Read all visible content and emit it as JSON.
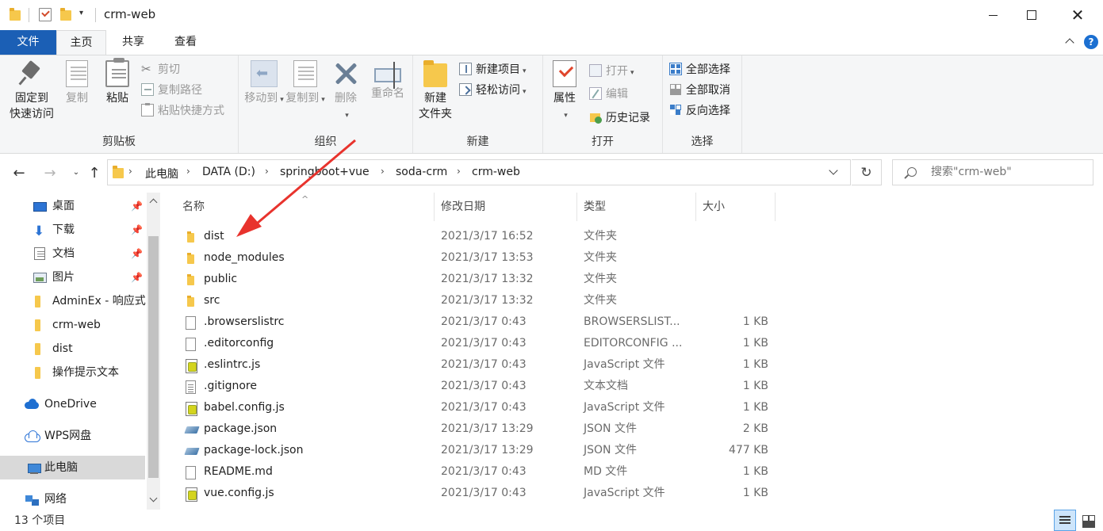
{
  "window": {
    "title": "crm-web",
    "minimize_icon": "minimize-icon",
    "maximize_icon": "maximize-icon",
    "close_label": "✕",
    "quick_access_dropdown": "▾"
  },
  "ribbon_tabs": {
    "file": "文件",
    "home": "主页",
    "share": "共享",
    "view": "查看",
    "help_label": "?"
  },
  "ribbon": {
    "clipboard": {
      "label": "剪贴板",
      "pin_line1": "固定到",
      "pin_line2": "快速访问",
      "copy": "复制",
      "paste": "粘贴",
      "cut": "剪切",
      "copy_path": "复制路径",
      "paste_shortcut": "粘贴快捷方式"
    },
    "organize": {
      "label": "组织",
      "move_to": "移动到",
      "copy_to": "复制到",
      "delete": "删除",
      "rename": "重命名"
    },
    "new": {
      "label": "新建",
      "new_folder_line1": "新建",
      "new_folder_line2": "文件夹",
      "new_item": "新建项目",
      "easy_access": "轻松访问"
    },
    "open": {
      "label": "打开",
      "properties": "属性",
      "open": "打开",
      "edit": "编辑",
      "history": "历史记录"
    },
    "select": {
      "label": "选择",
      "select_all": "全部选择",
      "select_none": "全部取消",
      "invert_selection": "反向选择"
    }
  },
  "address": {
    "breadcrumbs": [
      "此电脑",
      "DATA (D:)",
      "springboot+vue",
      "soda-crm",
      "crm-web"
    ],
    "separator": "›",
    "back": "←",
    "forward": "→",
    "recent": "⌄",
    "up": "↑",
    "refresh": "↻",
    "search_placeholder": "搜索\"crm-web\""
  },
  "navpane": {
    "items": [
      {
        "label": "桌面",
        "icon": "desktop-icon",
        "pinned": true
      },
      {
        "label": "下载",
        "icon": "download-icon",
        "pinned": true
      },
      {
        "label": "文档",
        "icon": "document-icon",
        "pinned": true
      },
      {
        "label": "图片",
        "icon": "picture-icon",
        "pinned": true
      },
      {
        "label": "AdminEx - 响应式",
        "icon": "folder-icon",
        "pinned": false
      },
      {
        "label": "crm-web",
        "icon": "folder-icon",
        "pinned": false
      },
      {
        "label": "dist",
        "icon": "folder-icon",
        "pinned": false
      },
      {
        "label": "操作提示文本",
        "icon": "folder-icon",
        "pinned": false
      },
      {
        "label": "OneDrive",
        "icon": "onedrive-icon",
        "pinned": false
      },
      {
        "label": "WPS网盘",
        "icon": "wps-cloud-icon",
        "pinned": false
      },
      {
        "label": "此电脑",
        "icon": "this-pc-icon",
        "pinned": false,
        "selected": true
      },
      {
        "label": "网络",
        "icon": "network-icon",
        "pinned": false
      }
    ],
    "pin_glyph": "📌"
  },
  "filelist": {
    "columns": {
      "name": "名称",
      "date": "修改日期",
      "type": "类型",
      "size": "大小"
    },
    "sort_glyph": "^",
    "rows": [
      {
        "name": "dist",
        "date": "2021/3/17 16:52",
        "type": "文件夹",
        "size": "",
        "kind": "folder"
      },
      {
        "name": "node_modules",
        "date": "2021/3/17 13:53",
        "type": "文件夹",
        "size": "",
        "kind": "folder"
      },
      {
        "name": "public",
        "date": "2021/3/17 13:32",
        "type": "文件夹",
        "size": "",
        "kind": "folder"
      },
      {
        "name": "src",
        "date": "2021/3/17 13:32",
        "type": "文件夹",
        "size": "",
        "kind": "folder"
      },
      {
        "name": ".browserslistrc",
        "date": "2021/3/17 0:43",
        "type": "BROWSERSLIST...",
        "size": "1 KB",
        "kind": "file"
      },
      {
        "name": ".editorconfig",
        "date": "2021/3/17 0:43",
        "type": "EDITORCONFIG ...",
        "size": "1 KB",
        "kind": "file"
      },
      {
        "name": ".eslintrc.js",
        "date": "2021/3/17 0:43",
        "type": "JavaScript 文件",
        "size": "1 KB",
        "kind": "js"
      },
      {
        "name": ".gitignore",
        "date": "2021/3/17 0:43",
        "type": "文本文档",
        "size": "1 KB",
        "kind": "text"
      },
      {
        "name": "babel.config.js",
        "date": "2021/3/17 0:43",
        "type": "JavaScript 文件",
        "size": "1 KB",
        "kind": "js"
      },
      {
        "name": "package.json",
        "date": "2021/3/17 13:29",
        "type": "JSON 文件",
        "size": "2 KB",
        "kind": "json"
      },
      {
        "name": "package-lock.json",
        "date": "2021/3/17 13:29",
        "type": "JSON 文件",
        "size": "477 KB",
        "kind": "json"
      },
      {
        "name": "README.md",
        "date": "2021/3/17 0:43",
        "type": "MD 文件",
        "size": "1 KB",
        "kind": "file"
      },
      {
        "name": "vue.config.js",
        "date": "2021/3/17 0:43",
        "type": "JavaScript 文件",
        "size": "1 KB",
        "kind": "js"
      }
    ]
  },
  "status": {
    "item_count": "13 个项目"
  },
  "colors": {
    "accent": "#1b5fb5",
    "folder": "#f6c84c",
    "annotation_arrow": "#e8332d"
  }
}
